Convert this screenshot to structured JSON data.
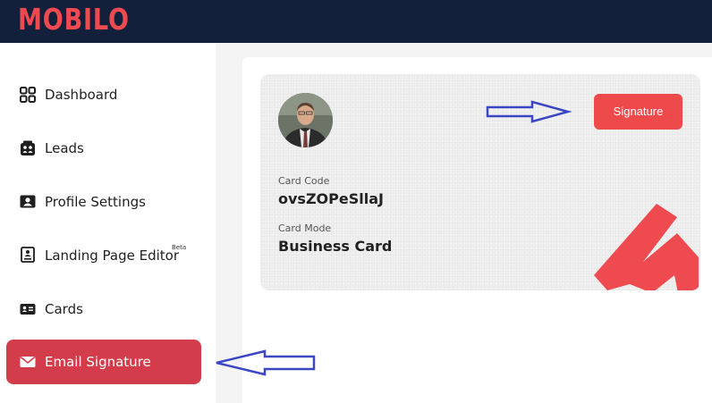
{
  "app": {
    "logo_text": "MOBILO",
    "brand_color": "#ef4a4f",
    "topbar_color": "#12203b",
    "active_color": "#d33d4b"
  },
  "sidebar": {
    "items": [
      {
        "label": "Dashboard",
        "icon": "dashboard-grid-icon"
      },
      {
        "label": "Leads",
        "icon": "leads-people-icon"
      },
      {
        "label": "Profile Settings",
        "icon": "profile-card-icon"
      },
      {
        "label": "Landing Page Editor",
        "icon": "landing-page-icon",
        "badge": "Beta"
      },
      {
        "label": "Cards",
        "icon": "id-card-icon"
      },
      {
        "label": "Email Signature",
        "icon": "envelope-icon",
        "active": true
      }
    ]
  },
  "card": {
    "signature_button": "Signature",
    "code_label": "Card Code",
    "code_value": "ovsZOPeSllaJ",
    "mode_label": "Card Mode",
    "mode_value": "Business Card"
  },
  "annotations": {
    "arrow_color": "#3a46c4"
  }
}
